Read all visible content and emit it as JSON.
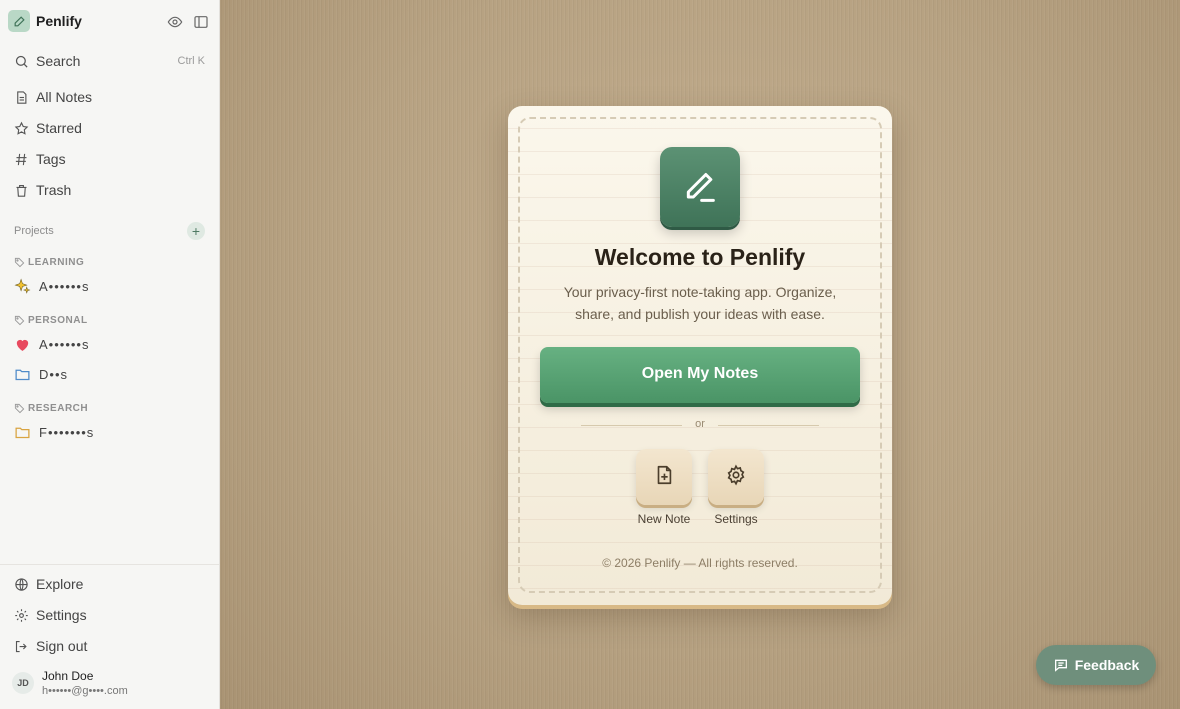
{
  "app": {
    "name": "Penlify"
  },
  "sidebar": {
    "search": {
      "label": "Search",
      "shortcut": "Ctrl K"
    },
    "nav": [
      {
        "label": "All Notes",
        "icon": "file-icon"
      },
      {
        "label": "Starred",
        "icon": "star-icon"
      },
      {
        "label": "Tags",
        "icon": "hash-icon"
      },
      {
        "label": "Trash",
        "icon": "trash-icon"
      }
    ],
    "projects_label": "Projects",
    "groups": [
      {
        "label": "LEARNING",
        "items": [
          {
            "label": "A••••••s",
            "icon": "sparkles-icon"
          }
        ]
      },
      {
        "label": "PERSONAL",
        "items": [
          {
            "label": "A••••••s",
            "icon": "heart-icon"
          },
          {
            "label": "D••s",
            "icon": "folder-icon"
          }
        ]
      },
      {
        "label": "RESEARCH",
        "items": [
          {
            "label": "F•••••••s",
            "icon": "folder-icon"
          }
        ]
      }
    ],
    "footer": [
      {
        "label": "Explore",
        "icon": "globe-icon"
      },
      {
        "label": "Settings",
        "icon": "gear-icon"
      },
      {
        "label": "Sign out",
        "icon": "sign-out-icon"
      }
    ],
    "user": {
      "initials": "JD",
      "name": "John Doe",
      "email": "h••••••@g••••.com"
    }
  },
  "card": {
    "title": "Welcome to Penlify",
    "subtitle": "Your privacy-first note-taking app. Organize, share, and publish your ideas with ease.",
    "primary_button": "Open My Notes",
    "or_text": "or",
    "actions": [
      {
        "label": "New Note",
        "icon": "file-plus-icon"
      },
      {
        "label": "Settings",
        "icon": "gear-icon"
      }
    ],
    "copyright": "© 2026 Penlify — All rights reserved."
  },
  "feedback": {
    "label": "Feedback"
  },
  "colors": {
    "accent": "#4a9466",
    "brand_icon_bg": "#b9d8c6",
    "feedback_bg": "#6f8f7c"
  }
}
